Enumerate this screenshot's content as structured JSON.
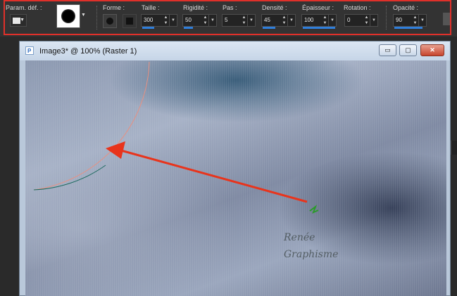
{
  "toolbar": {
    "preset_label": "Param. déf. :",
    "shape_label": "Forme :",
    "size": {
      "label": "Taille :",
      "value": "300"
    },
    "hardness": {
      "label": "Rigidité :",
      "value": "50"
    },
    "step": {
      "label": "Pas :",
      "value": "5"
    },
    "density": {
      "label": "Densité :",
      "value": "45"
    },
    "thickness": {
      "label": "Épaisseur :",
      "value": "100"
    },
    "rotation": {
      "label": "Rotation :",
      "value": "0"
    },
    "opacity": {
      "label": "Opacité :",
      "value": "90"
    },
    "highlight_color": "#e0302a"
  },
  "document_window": {
    "title": "Image3* @ 100% (Raster 1)",
    "minimize_glyph": "▭",
    "restore_glyph": "▢",
    "close_glyph": "✕"
  },
  "canvas": {
    "watermark_lines": [
      "Renée",
      "Graphisme"
    ],
    "annotation_arrow_color": "#e8341c"
  }
}
